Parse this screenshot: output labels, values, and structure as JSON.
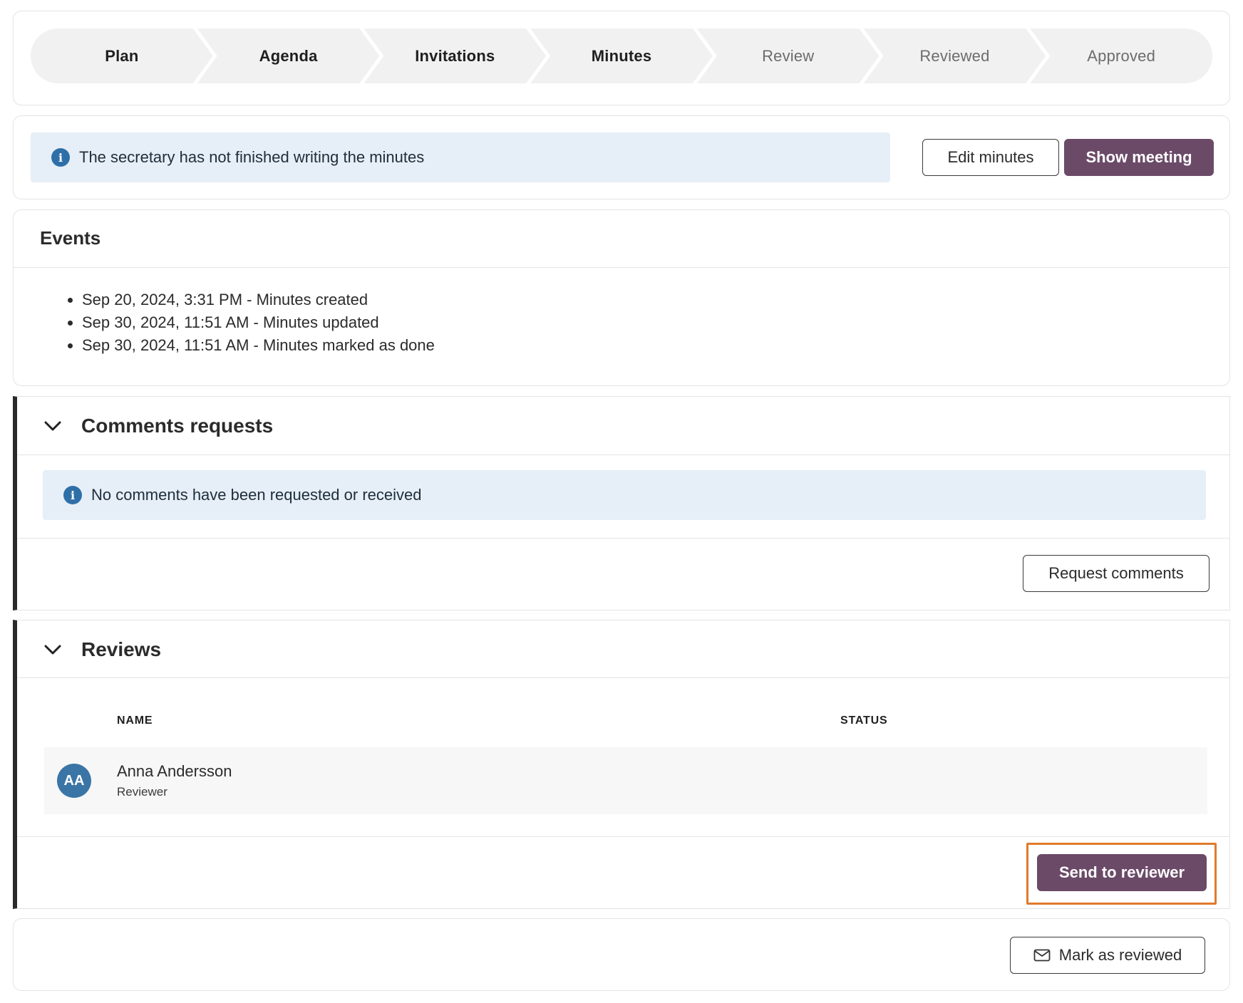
{
  "stepper": {
    "steps": [
      {
        "label": "Plan",
        "state": "done"
      },
      {
        "label": "Agenda",
        "state": "done"
      },
      {
        "label": "Invitations",
        "state": "done"
      },
      {
        "label": "Minutes",
        "state": "done"
      },
      {
        "label": "Review",
        "state": "todo"
      },
      {
        "label": "Reviewed",
        "state": "todo"
      },
      {
        "label": "Approved",
        "state": "todo"
      }
    ]
  },
  "status": {
    "message": "The secretary has not finished writing the minutes",
    "icon": "info-icon",
    "edit_label": "Edit minutes",
    "show_label": "Show meeting"
  },
  "events": {
    "title": "Events",
    "items": [
      "Sep 20, 2024, 3:31 PM - Minutes created",
      "Sep 30, 2024, 11:51 AM - Minutes updated",
      "Sep 30, 2024, 11:51 AM - Minutes marked as done"
    ]
  },
  "comments": {
    "title": "Comments requests",
    "empty_message": "No comments have been requested or received",
    "request_label": "Request comments"
  },
  "reviews": {
    "title": "Reviews",
    "columns": [
      "NAME",
      "STATUS"
    ],
    "rows": [
      {
        "initials": "AA",
        "name": "Anna Andersson",
        "role": "Reviewer",
        "status": ""
      }
    ],
    "send_label": "Send to reviewer"
  },
  "footer": {
    "mark_label": "Mark as reviewed",
    "icon": "mail-icon"
  },
  "colors": {
    "primary": "#6b4a68",
    "info_bg": "#e6eff7",
    "info_icon": "#2f6fa8",
    "avatar": "#3a75a6",
    "highlight": "#e07a2c"
  }
}
